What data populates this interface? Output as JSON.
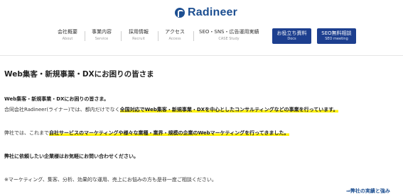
{
  "logo": {
    "text": "Radineer"
  },
  "nav": {
    "items": [
      {
        "jp": "会社概要",
        "en": "About"
      },
      {
        "jp": "事業内容",
        "en": "Service"
      },
      {
        "jp": "採用情報",
        "en": "Recruit"
      },
      {
        "jp": "アクセス",
        "en": "Access"
      },
      {
        "jp": "SEO・SNS・広告運用実績",
        "en": "CASE Study"
      }
    ],
    "docs_button": {
      "jp": "お役立ち資料",
      "en": "Docs"
    },
    "meeting_button": {
      "jp": "SEO無料相談",
      "en": "SEO meeting"
    }
  },
  "main": {
    "title": "Web集客・新規事業・DXにお困りの皆さま",
    "lead": "Web集客・新規事業・DXにお困りの皆さま。",
    "p1_pre": "合同会社Radineer(ライナー)では、都内だけでなく",
    "p1_hl": "全国対応でWeb集客・新規事業・DXを中心としたコンサルティングなどの事業を行っています。",
    "p2_pre": "弊社では、これまで",
    "p2_hl": "自社サービスのマーケティングや様々な業種・業界・規模の企業のWebマーケティングを行ってきました。",
    "p3": "弊社に依頼したい企業様はお気軽にお問い合わせください。",
    "p4": "※マーケティング、集客、分析、効果的な運用、売上にお悩みの方も是非一度ご相談ください。",
    "footer_link": "⇒弊社の実績と強み"
  }
}
